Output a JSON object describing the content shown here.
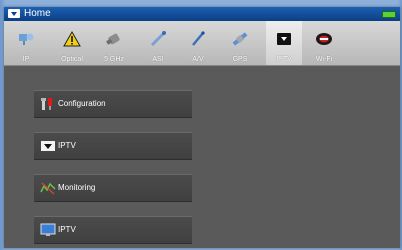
{
  "window": {
    "title": "Home"
  },
  "tabs": [
    {
      "label": "IP",
      "icon": "network-icon"
    },
    {
      "label": "Optical",
      "icon": "warning-icon"
    },
    {
      "label": "5 GHz",
      "icon": "satellite-icon"
    },
    {
      "label": "ASI",
      "icon": "cable-icon"
    },
    {
      "label": "A/V",
      "icon": "probe-icon"
    },
    {
      "label": "GPS",
      "icon": "gps-satellite-icon"
    },
    {
      "label": "IPTV",
      "icon": "iptv-tab-icon"
    },
    {
      "label": "Wi-Fi",
      "icon": "wifi-icon"
    }
  ],
  "active_tab": "IPTV",
  "menu": [
    {
      "label": "Configuration",
      "icon": "tools-icon"
    },
    {
      "label": "IPTV",
      "icon": "iptv-icon"
    },
    {
      "label": "Monitoring",
      "icon": "monitoring-icon"
    },
    {
      "label": "IPTV",
      "icon": "tv-monitor-icon"
    }
  ],
  "colors": {
    "titlebar": "#0b3f85",
    "accent": "#d9b10a",
    "battery": "#5ccf3a"
  }
}
